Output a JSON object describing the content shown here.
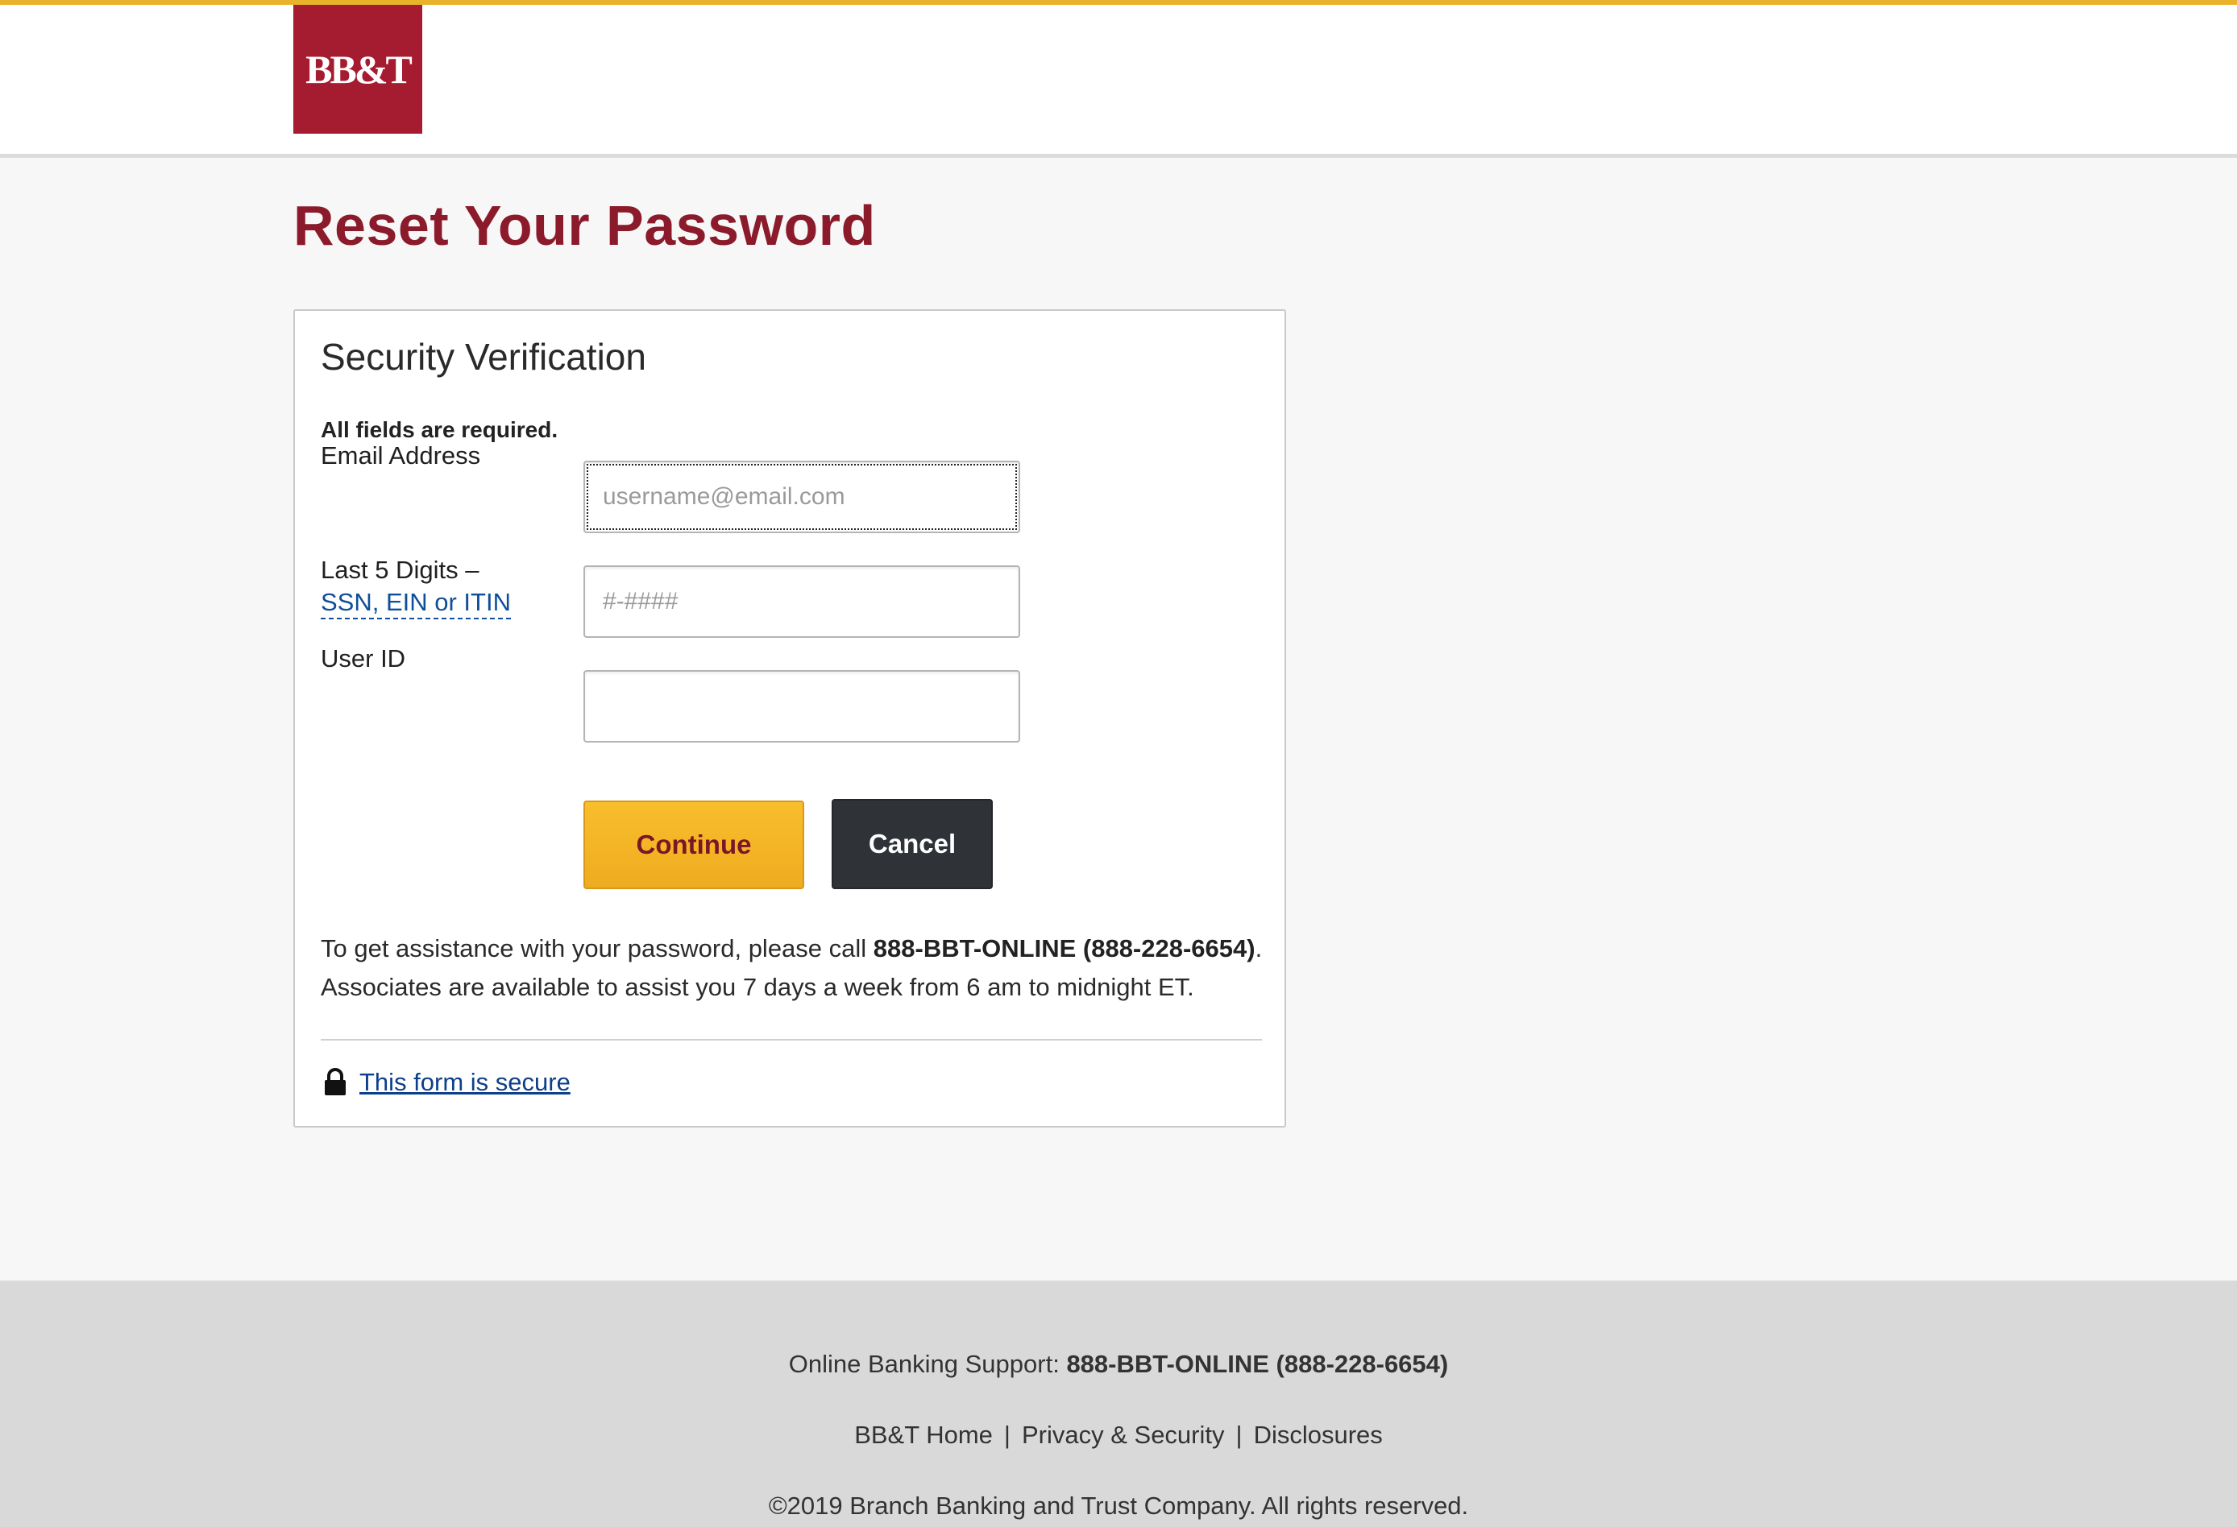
{
  "header": {
    "logo_text": "BB&T",
    "accent_color": "#e8b32a",
    "logo_color": "#a51c30"
  },
  "page": {
    "title": "Reset Your Password"
  },
  "form": {
    "title": "Security Verification",
    "required_note": "All fields are required.",
    "email": {
      "label": "Email Address",
      "placeholder": "username@email.com",
      "value": ""
    },
    "ssn": {
      "label": "Last 5 Digits –",
      "link_label": "SSN, EIN or ITIN",
      "placeholder": "#-####",
      "value": ""
    },
    "user_id": {
      "label": "User ID",
      "placeholder": "",
      "value": ""
    },
    "continue_label": "Continue",
    "cancel_label": "Cancel",
    "help": {
      "prefix": "To get assistance with your password, please call ",
      "phone": "888-BBT-ONLINE (888-228-6654)",
      "suffix": ".",
      "line2": "Associates are available to assist you 7 days a week from 6 am to midnight ET."
    },
    "secure_link": "This form is secure",
    "secure_icon": "lock-icon"
  },
  "footer": {
    "support_label": "Online Banking Support: ",
    "support_phone": "888-BBT-ONLINE (888-228-6654)",
    "links": [
      "BB&T Home",
      "Privacy & Security",
      "Disclosures"
    ],
    "copyright": "©2019 Branch Banking and Trust Company. All rights reserved."
  }
}
